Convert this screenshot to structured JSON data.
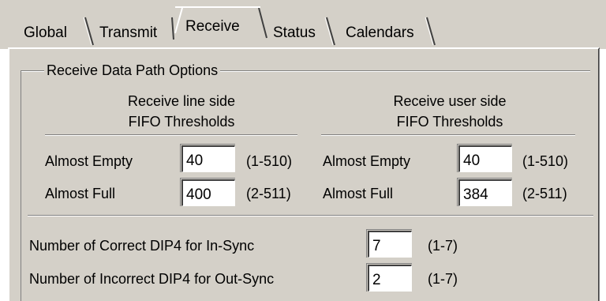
{
  "tabs": [
    {
      "label": "Global",
      "active": false
    },
    {
      "label": "Transmit",
      "active": false
    },
    {
      "label": "Receive",
      "active": true
    },
    {
      "label": "Status",
      "active": false
    },
    {
      "label": "Calendars",
      "active": false
    }
  ],
  "group": {
    "title": "Receive Data Path Options"
  },
  "line_side": {
    "heading_line1": "Receive line side",
    "heading_line2": "FIFO Thresholds",
    "almost_empty_label": "Almost Empty",
    "almost_empty_value": "40",
    "almost_empty_range": "(1-510)",
    "almost_full_label": "Almost Full",
    "almost_full_value": "400",
    "almost_full_range": "(2-511)"
  },
  "user_side": {
    "heading_line1": "Receive user side",
    "heading_line2": "FIFO Thresholds",
    "almost_empty_label": "Almost Empty",
    "almost_empty_value": "40",
    "almost_empty_range": "(1-510)",
    "almost_full_label": "Almost Full",
    "almost_full_value": "384",
    "almost_full_range": "(2-511)"
  },
  "dip4": {
    "correct_label": "Number of Correct DIP4 for In-Sync",
    "correct_value": "7",
    "correct_range": "(1-7)",
    "incorrect_label": "Number of Incorrect DIP4 for Out-Sync",
    "incorrect_value": "2",
    "incorrect_range": "(1-7)"
  },
  "colors": {
    "face": "#d4d0c8",
    "shadow": "#808080",
    "dark_shadow": "#404040",
    "highlight": "#ffffff"
  }
}
